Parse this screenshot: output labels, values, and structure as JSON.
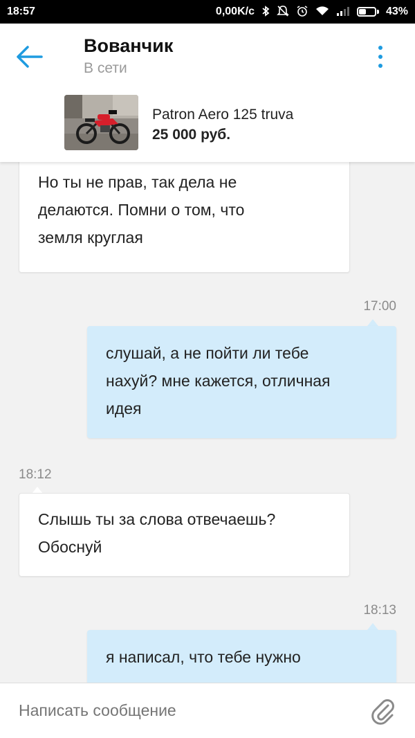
{
  "status_bar": {
    "time": "18:57",
    "speed": "0,00K/c",
    "battery": "43%",
    "battery_level": 0.43
  },
  "header": {
    "contact_name": "Вованчик",
    "contact_status": "В сети"
  },
  "listing": {
    "title": "Patron Aero 125 truva",
    "price": "25 000 руб."
  },
  "messages": [
    {
      "direction": "incoming",
      "lines": [
        "Но ты не прав, так дела не",
        "делаются. Помни о том, что",
        "земля круглая"
      ]
    },
    {
      "direction": "outgoing",
      "time": "17:00",
      "lines": [
        "слушай, а не пойти ли тебе",
        "нахуй? мне кажется, отличная",
        "идея"
      ]
    },
    {
      "direction": "incoming",
      "time": "18:12",
      "lines": [
        "Слышь ты за слова отвечаешь?",
        "Обоснуй"
      ]
    },
    {
      "direction": "outgoing",
      "time": "18:13",
      "lines": [
        "я написал, что тебе нужно"
      ]
    }
  ],
  "composer": {
    "placeholder": "Написать сообщение"
  },
  "colors": {
    "accent": "#1e9be0",
    "outgoing_bubble": "#d3ecfb",
    "incoming_bubble": "#ffffff",
    "background": "#f2f2f2"
  }
}
